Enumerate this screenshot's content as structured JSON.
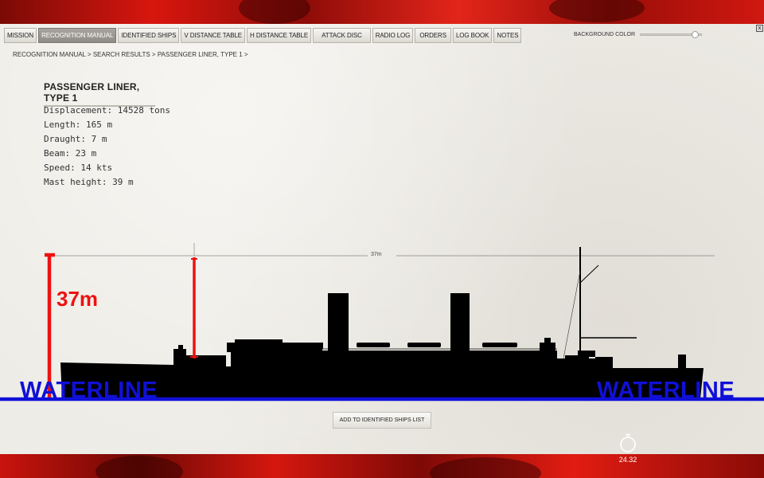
{
  "tabs": [
    {
      "label": "MISSION",
      "active": false
    },
    {
      "label": "RECOGNITION MANUAL",
      "active": true
    },
    {
      "label": "IDENTIFIED SHIPS",
      "active": false
    },
    {
      "label": "V DISTANCE TABLE",
      "active": false
    },
    {
      "label": "H DISTANCE TABLE",
      "active": false
    },
    {
      "label": "ATTACK DISC",
      "active": false
    },
    {
      "label": "RADIO LOG",
      "active": false
    },
    {
      "label": "ORDERS",
      "active": false
    },
    {
      "label": "LOG BOOK",
      "active": false
    },
    {
      "label": "NOTES",
      "active": false
    }
  ],
  "close_label": "x",
  "background_color": {
    "label": "BACKGROUND COLOR",
    "value": 0.95
  },
  "breadcrumb": "RECOGNITION MANUAL > SEARCH RESULTS > PASSENGER LINER, TYPE 1 >",
  "ship": {
    "title": "PASSENGER LINER, TYPE 1",
    "specs": [
      "Displacement: 14528 tons",
      "Length: 165 m",
      "Draught: 7 m",
      "Beam: 23 m",
      "Speed: 14 kts",
      "Mast height: 39 m"
    ]
  },
  "drawing": {
    "mast_line_label": "37m",
    "height_annotation": "37m",
    "waterline_left": "WATERLINE",
    "waterline_right": "WATERLINE",
    "annotation_red": "#ee1111",
    "waterline_blue": "#1010d8"
  },
  "add_button_label": "ADD TO IDENTIFIED SHIPS LIST",
  "timer": {
    "value": "24.32",
    "icon": "stopwatch-icon"
  }
}
